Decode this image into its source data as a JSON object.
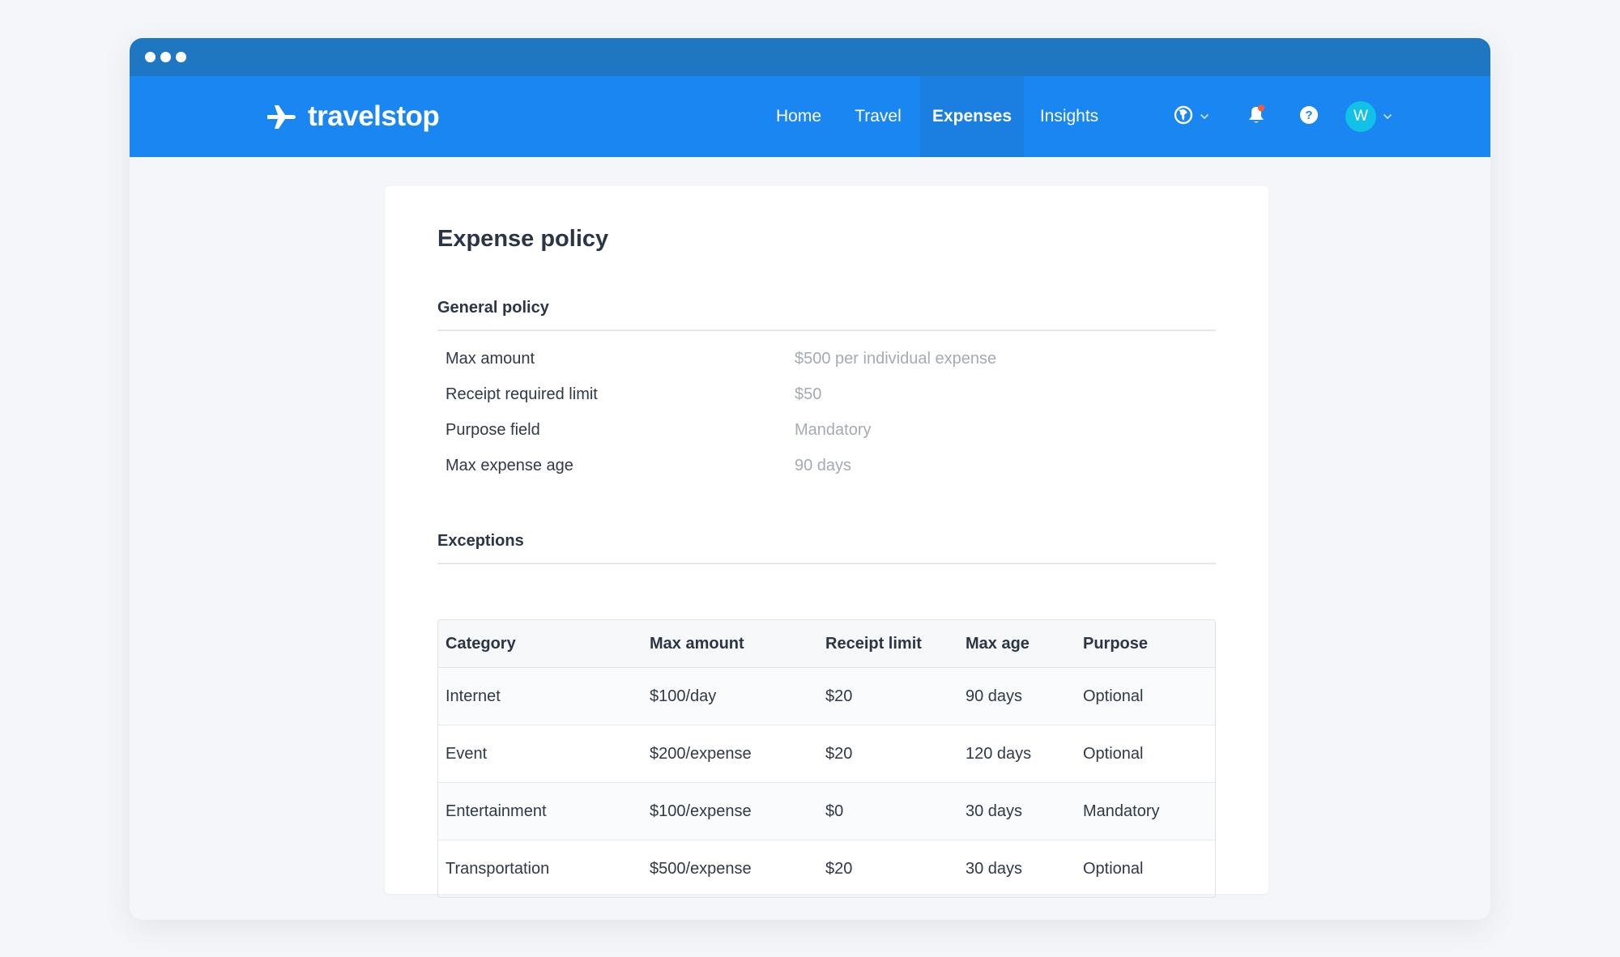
{
  "window": {
    "dots": 3
  },
  "brand": {
    "name": "travelstop",
    "text_color": "#ffffff",
    "nav_color": "#1a86f2",
    "titlebar_color": "#1f76c1"
  },
  "nav": {
    "links": [
      {
        "label": "Home",
        "active": false
      },
      {
        "label": "Travel",
        "active": false
      },
      {
        "label": "Expenses",
        "active": true
      },
      {
        "label": "Insights",
        "active": false
      }
    ],
    "icons": {
      "globe": "globe-icon",
      "notifications": "bell-icon",
      "help": "help-icon",
      "notification_badge_color": "#ff5a36"
    },
    "user": {
      "initial": "W",
      "avatar_color": "#12c1e8"
    }
  },
  "page": {
    "title": "Expense policy",
    "general": {
      "title": "General policy",
      "rows": [
        {
          "label": "Max amount",
          "value": "$500 per individual expense"
        },
        {
          "label": "Receipt required limit",
          "value": "$50"
        },
        {
          "label": "Purpose field",
          "value": "Mandatory"
        },
        {
          "label": "Max expense age",
          "value": "90 days"
        }
      ]
    },
    "exceptions": {
      "title": "Exceptions",
      "columns": [
        "Category",
        "Max amount",
        "Receipt limit",
        "Max age",
        "Purpose"
      ],
      "rows": [
        [
          "Internet",
          "$100/day",
          "$20",
          "90 days",
          "Optional"
        ],
        [
          "Event",
          "$200/expense",
          "$20",
          "120 days",
          "Optional"
        ],
        [
          "Entertainment",
          "$100/expense",
          "$0",
          "30 days",
          "Mandatory"
        ],
        [
          "Transportation",
          "$500/expense",
          "$20",
          "30 days",
          "Optional"
        ]
      ]
    }
  }
}
